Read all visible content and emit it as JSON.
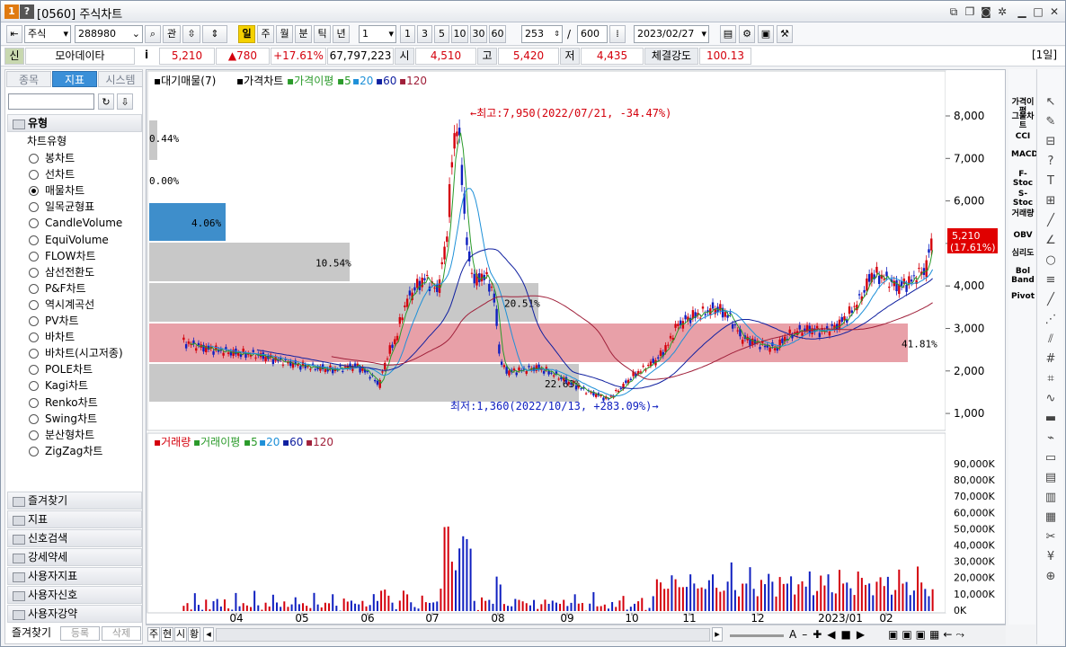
{
  "window": {
    "number": "1",
    "help": "?",
    "title": "[0560] 주식차트"
  },
  "toolbar": {
    "market": "주식",
    "code": "288980",
    "search_btn": "관",
    "periods": [
      "일",
      "주",
      "월",
      "분",
      "틱",
      "년"
    ],
    "selected_period": "일",
    "interval": "1",
    "quick_intervals": [
      "1",
      "3",
      "5",
      "10",
      "30",
      "60"
    ],
    "count": "253",
    "total": "600",
    "slash": "/",
    "date": "2023/02/27"
  },
  "quote": {
    "badge": "신",
    "name": "모아데이타",
    "info": "i",
    "price": "5,210",
    "change": "▲780",
    "change_pct": "+17.61%",
    "volume": "67,797,223",
    "open_label": "시",
    "open": "4,510",
    "high_label": "고",
    "high": "5,420",
    "low_label": "저",
    "low": "4,435",
    "strength_label": "체결강도",
    "strength": "100.13",
    "period_badge": "[1일]"
  },
  "sidebar": {
    "tabs": [
      "종목",
      "지표",
      "시스템"
    ],
    "active_tab": "지표",
    "section": "유형",
    "subsection": "차트유형",
    "chart_types": [
      "봉차트",
      "선차트",
      "매물차트",
      "일목균형표",
      "CandleVolume",
      "EquiVolume",
      "FLOW차트",
      "삼선전환도",
      "P&F차트",
      "역시계곡선",
      "PV차트",
      "바차트",
      "바차트(시고저종)",
      "POLE차트",
      "Kagi차트",
      "Renko차트",
      "Swing차트",
      "분산형차트",
      "ZigZag차트"
    ],
    "selected_type": "매물차트",
    "folders": [
      "즐겨찾기",
      "지표",
      "신호검색",
      "강세약세",
      "사용자지표",
      "사용자신호",
      "사용자강약"
    ],
    "bottom_buttons": [
      "즐겨찾기",
      "등록",
      "삭제"
    ]
  },
  "price_panel": {
    "legend": [
      {
        "t": "대기매물(7)",
        "c": "#000"
      },
      {
        "t": "가격차트",
        "c": "#000"
      },
      {
        "t": "가격이평",
        "c": "#2a9a2a"
      },
      {
        "t": "5",
        "c": "#2a9a2a"
      },
      {
        "t": "20",
        "c": "#1e90d8"
      },
      {
        "t": "60",
        "c": "#1020a0"
      },
      {
        "t": "120",
        "c": "#a0203a"
      }
    ],
    "high_note": "←최고:7,950(2022/07/21, -34.47%)",
    "low_note": "최저:1,360(2022/10/13, +283.09%)→",
    "last_price": "5,210",
    "last_pct": "(17.61%)",
    "y_ticks": [
      "8,000",
      "7,000",
      "6,000",
      "5,000",
      "4,000",
      "3,000",
      "2,000",
      "1,000"
    ]
  },
  "volume_profile": [
    {
      "label": "0.44%",
      "pct": 0.44
    },
    {
      "label": "0.00%",
      "pct": 0.0
    },
    {
      "label": "4.06%",
      "pct": 4.06
    },
    {
      "label": "10.54%",
      "pct": 10.54
    },
    {
      "label": "20.51%",
      "pct": 20.51
    },
    {
      "label": "41.81%",
      "pct": 41.81
    },
    {
      "label": "22.63%",
      "pct": 22.63
    }
  ],
  "volume_panel": {
    "legend": [
      {
        "t": "거래량",
        "c": "#d4000c"
      },
      {
        "t": "거래이평",
        "c": "#2a9a2a"
      },
      {
        "t": "5",
        "c": "#2a9a2a"
      },
      {
        "t": "20",
        "c": "#1e90d8"
      },
      {
        "t": "60",
        "c": "#1020a0"
      },
      {
        "t": "120",
        "c": "#a0203a"
      }
    ],
    "y_ticks": [
      "90,000K",
      "80,000K",
      "70,000K",
      "60,000K",
      "50,000K",
      "40,000K",
      "30,000K",
      "20,000K",
      "10,000K",
      "0K"
    ]
  },
  "x_ticks": [
    "04",
    "05",
    "06",
    "07",
    "08",
    "09",
    "10",
    "11",
    "12",
    "2023/01",
    "02"
  ],
  "bottom_bar": {
    "buttons": [
      "주",
      "현",
      "시",
      "황"
    ]
  },
  "indicators": [
    "가격이평",
    "그물차트",
    "CCI",
    "MACD",
    "F-Stoc",
    "S-Stoc",
    "거래량",
    "OBV",
    "심리도",
    "Bol Band",
    "Pivot"
  ],
  "colors": {
    "up": "#d4000c",
    "down": "#1020c0",
    "profile_gray": "#c8c8c8",
    "profile_blue": "#3e8ecb",
    "profile_pink": "#e8a0a8"
  },
  "chart_data": {
    "type": "candlestick",
    "title": "",
    "ylim": [
      1000,
      8000
    ],
    "high": {
      "value": 7950,
      "date": "2022/07/21"
    },
    "low": {
      "value": 1360,
      "date": "2022/10/13"
    },
    "last": 5210,
    "months": [
      "04",
      "05",
      "06",
      "07",
      "08",
      "09",
      "10",
      "11",
      "12",
      "2023/01",
      "02"
    ]
  }
}
